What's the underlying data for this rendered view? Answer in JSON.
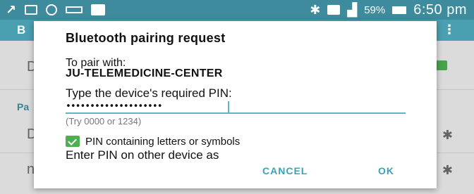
{
  "status_bar": {
    "signal_strength": "59%",
    "time": "6:50 pm",
    "icons": [
      "app-icon",
      "image-icon",
      "alarm-icon",
      "email-icon",
      "calendar-icon",
      "bluetooth-icon",
      "home-icon",
      "signal-icon",
      "battery-icon"
    ]
  },
  "app_bar": {
    "title_fragment": "B",
    "menu_fragment": "⋮"
  },
  "background": {
    "row1_letter": "D",
    "section_label": "Pa",
    "row2_letter": "D",
    "row3_letter": "n"
  },
  "dialog": {
    "title": "Bluetooth pairing request",
    "pair_with_label": "To pair with:",
    "device_name": "JU-TELEMEDICINE-CENTER",
    "type_pin_label": "Type the device's required PIN:",
    "pin_value": "••••••••••••••••••••",
    "hint": "(Try 0000 or 1234)",
    "checkbox_label": "PIN containing letters or symbols",
    "checkbox_checked": true,
    "enter_pin_text": "Enter PIN on other device as",
    "cancel_label": "CANCEL",
    "ok_label": "OK"
  },
  "colors": {
    "accent": "#3aa3b8",
    "status_bar": "#3d8b9c",
    "check_green": "#4caf50"
  }
}
